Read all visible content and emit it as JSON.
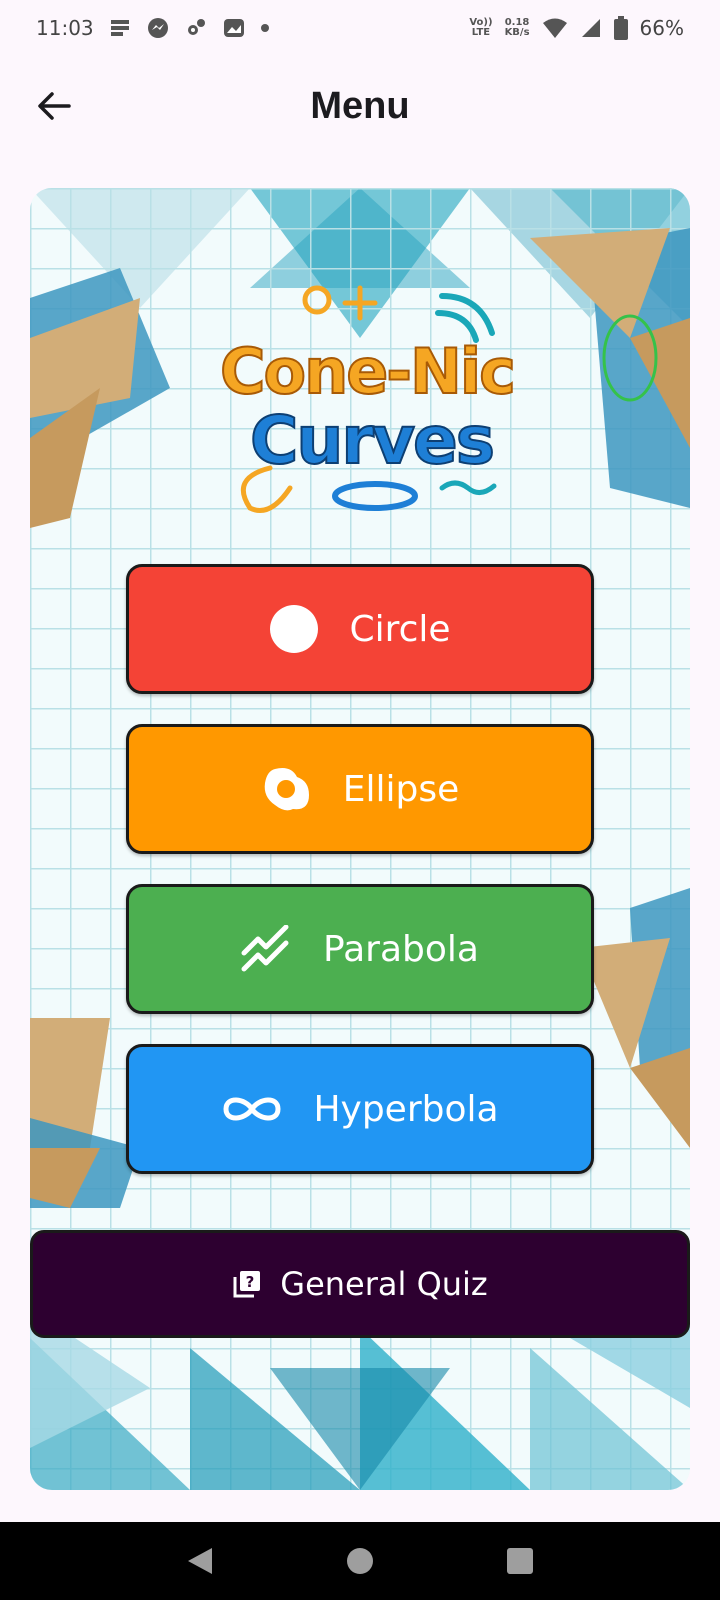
{
  "status_bar": {
    "time": "11:03",
    "net_type_top": "Vo))",
    "net_type_bottom": "LTE",
    "speed_value": "0.18",
    "speed_unit": "KB/s",
    "battery": "66%"
  },
  "app_bar": {
    "title": "Menu",
    "back_icon": "arrow-left-icon"
  },
  "logo": {
    "line1": "Cone-Nic",
    "line2": "Curves"
  },
  "menu": {
    "items": [
      {
        "label": "Circle",
        "icon": "circle-icon",
        "color": "#f44336"
      },
      {
        "label": "Ellipse",
        "icon": "ellipse-icon",
        "color": "#ff9800"
      },
      {
        "label": "Parabola",
        "icon": "parabola-icon",
        "color": "#4caf50"
      },
      {
        "label": "Hyperbola",
        "icon": "hyperbola-icon",
        "color": "#2196f3"
      }
    ],
    "quiz": {
      "label": "General Quiz",
      "icon": "quiz-icon",
      "color": "#2d0030"
    }
  },
  "nav": {
    "back_icon": "nav-back-icon",
    "home_icon": "nav-home-icon",
    "recents_icon": "nav-recents-icon"
  }
}
